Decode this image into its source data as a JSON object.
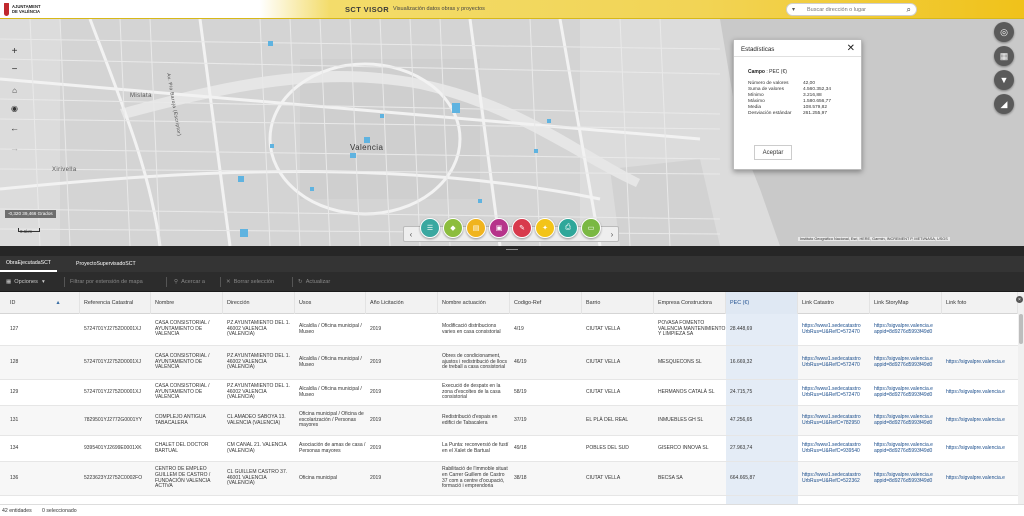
{
  "header": {
    "logo_text": "AJUNTAMENT DE VALÈNCIA",
    "title": "SCT VISOR",
    "subtitle": "Visualización datos obras y proyectos",
    "search_placeholder": "Buscar dirección o lugar",
    "search_dropdown_icon": "chevron-down-icon",
    "search_icon": "search-icon",
    "accent_color": "#f0c21a"
  },
  "map": {
    "labels": {
      "city": "Valencia",
      "mislata": "Mislata",
      "xirivella": "Xirivella",
      "road": "Av. Pio Baroja (Escriptor)"
    },
    "coordinates": "-0,320 39,466 Grados",
    "scale_label": "0.6km",
    "attribution": "Instituto Geográfico Nacional, Esri, HERE, Garmin, INCREMENT P, METI/NASA, USGS",
    "left_controls": [
      "plus-icon",
      "minus-icon",
      "home-icon",
      "locate-icon",
      "back-arrow-icon",
      "forward-arrow-icon"
    ],
    "right_controls": [
      "eye-off-icon",
      "grid-icon",
      "filter-icon",
      "chart-icon"
    ],
    "tool_circles": [
      {
        "icon": "list-icon",
        "color": "#3aa8a0"
      },
      {
        "icon": "layers-icon",
        "color": "#8cbd3e"
      },
      {
        "icon": "table-icon",
        "color": "#f0b41e"
      },
      {
        "icon": "report-icon",
        "color": "#b6338a"
      },
      {
        "icon": "tools-icon",
        "color": "#d83a4c"
      },
      {
        "icon": "bulb-icon",
        "color": "#f3c419"
      },
      {
        "icon": "print-icon",
        "color": "#2fa79a"
      },
      {
        "icon": "save-icon",
        "color": "#7ab843"
      }
    ]
  },
  "stats": {
    "title": "Estadísticas",
    "campo_label": "Campo",
    "campo_value": ": PEC (€)",
    "rows": [
      {
        "k": "Número de valores",
        "v": "42,00"
      },
      {
        "k": "Suma de valores",
        "v": "4.560.352,34"
      },
      {
        "k": "Mínimo",
        "v": "3.216,88"
      },
      {
        "k": "Máximo",
        "v": "1.580.656,77"
      },
      {
        "k": "Media",
        "v": "108.579,82"
      },
      {
        "k": "Desviación estándar",
        "v": "261.255,97"
      }
    ],
    "ok_label": "Aceptar"
  },
  "tabs": [
    "ObraEjecutadaSCT",
    "ProyectoSupervisadoSCT"
  ],
  "options": {
    "opciones": "Opciones",
    "filtrar": "Filtrar por extensión de mapa",
    "acercar": "Acercar a",
    "borrar": "Borrar selección",
    "actualizar": "Actualizar"
  },
  "columns": [
    "ID",
    "Referencia Catastral",
    "Nombre",
    "Dirección",
    "Usos",
    "Año Licitación",
    "Nombre actuación",
    "Codigo-Ref",
    "Barrio",
    "Empresa Constructora",
    "PEC (€)",
    "Link Catastro",
    "Link StoryMap",
    "Link foto"
  ],
  "rows": [
    {
      "id": "127",
      "ref": "5724701YJ2752D0001XJ",
      "nombre": "CASA CONSISTORIAL / AYUNTAMIENTO DE VALENCIA",
      "dir": "PZ AYUNTAMIENTO DEL 1. 46002 VALENCIA (VALENCIA)",
      "usos": "Alcaldía / Oficina municipal / Museo",
      "anio": "2019",
      "act": "Modificació distribucions varies en casa consistorial",
      "cod": "4/19",
      "barrio": "CIUTAT VELLA",
      "emp": "POVASA FOMENTO VALENCIA MANTENIMIENTO Y LIMPIEZA SA",
      "pec": "28.448,69",
      "cat": "https://www1.sedecatastro UrbRus=U&RefC=572470",
      "story": "https://sigvalpre.valencia.e appid=8d9276d5993f49d0",
      "foto": ""
    },
    {
      "id": "128",
      "ref": "5724701YJ2752D0001XJ",
      "nombre": "CASA CONSISTORIAL / AYUNTAMIENTO DE VALENCIA",
      "dir": "PZ AYUNTAMIENTO DEL 1. 46002 VALENCIA (VALENCIA)",
      "usos": "Alcaldía / Oficina municipal / Museo",
      "anio": "2019",
      "act": "Obres de condicionament, ajustos i redistribució de llocs de treball a casa consistorial",
      "cod": "46/19",
      "barrio": "CIUTAT VELLA",
      "emp": "MESQUECONS SL",
      "pec": "16.669,32",
      "cat": "https://www1.sedecatastro UrbRus=U&RefC=572470",
      "story": "https://sigvalpre.valencia.e appid=8d9276d5993f49d0",
      "foto": "https://sigvalpre.valencia.e"
    },
    {
      "id": "129",
      "ref": "5724701YJ2752D0001XJ",
      "nombre": "CASA CONSISTORIAL / AYUNTAMIENTO DE VALENCIA",
      "dir": "PZ AYUNTAMIENTO DEL 1. 46002 VALENCIA (VALENCIA)",
      "usos": "Alcaldía / Oficina municipal / Museo",
      "anio": "2019",
      "act": "Execució de despatx en la zona d'escoltes de la casa consistorial",
      "cod": "58/19",
      "barrio": "CIUTAT VELLA",
      "emp": "HERMANOS CATALÀ SL",
      "pec": "24.715,75",
      "cat": "https://www1.sedecatastro UrbRus=U&RefC=572470",
      "story": "https://sigvalpre.valencia.e appid=8d9276d5993f49d0",
      "foto": "https://sigvalpre.valencia.e"
    },
    {
      "id": "131",
      "ref": "7829501YJ2772G0001YY",
      "nombre": "COMPLEJO ANTIGUA TABACALERA",
      "dir": "CL AMADEO SABOYA 13. VALENCIA (VALENCIA)",
      "usos": "Oficina municipal / Oficina de escolarización / Personas mayores",
      "anio": "2019",
      "act": "Redistribució d'espais en edifici de Tabacalera",
      "cod": "37/19",
      "barrio": "EL PLÀ DEL REAL",
      "emp": "INMUEBLES GH SL",
      "pec": "47.256,65",
      "cat": "https://www1.sedecatastro UrbRus=U&RefC=782950",
      "story": "https://sigvalpre.valencia.e appid=8d9276d5993f49d0",
      "foto": "https://sigvalpre.valencia.e"
    },
    {
      "id": "134",
      "ref": "9395401YJ2699E0001XK",
      "nombre": "CHALET DEL DOCTOR BARTUAL",
      "dir": "CM CANAL 21. VALENCIA (VALENCIA)",
      "usos": "Asociación de amas de casa / Personas mayores",
      "anio": "2019",
      "act": "La Punta: reconversió de fustí en el Xalet de Bartual",
      "cod": "49/18",
      "barrio": "POBLES DEL SUD",
      "emp": "GISERCO INNOVA SL",
      "pec": "27.963,74",
      "cat": "https://www1.sedecatastro UrbRus=U&RefC=939540",
      "story": "https://sigvalpre.valencia.e appid=8d9276d5993f49d0",
      "foto": "https://sigvalpre.valencia.e"
    },
    {
      "id": "136",
      "ref": "5223623YJ2752C0002FO",
      "nombre": "CENTRO DE EMPLEO GUILLEM DE CASTRO / FUNDACIÓN VALENCIA ACTIVA",
      "dir": "CL GUILLEM CASTRO 37. 46001 VALENCIA (VALENCIA)",
      "usos": "Oficina municipal",
      "anio": "2019",
      "act": "Rabilitació de l'immoble situat en Carrer Guillem de Castro 37 com a centre d'ocupació, formació i emprendoria",
      "cod": "38/18",
      "barrio": "CIUTAT VELLA",
      "emp": "BECSA SA",
      "pec": "664.665,87",
      "cat": "https://www1.sedecatastro UrbRus=U&RefC=522362",
      "story": "https://sigvalpre.valencia.e appid=8d9276d5993f49d0",
      "foto": "https://sigvalpre.valencia.e"
    },
    {
      "id": "",
      "ref": "",
      "nombre": "CENTRO CIVICO EN",
      "dir": "CL JOSEP DE",
      "usos": "",
      "anio": "",
      "act": "Obres de demolició i",
      "cod": "",
      "barrio": "",
      "emp": "LEVANTINA",
      "pec": "",
      "cat": "",
      "story": "",
      "foto": ""
    }
  ],
  "footer": {
    "count": "42 entidades",
    "selected": "0 seleccionado"
  }
}
